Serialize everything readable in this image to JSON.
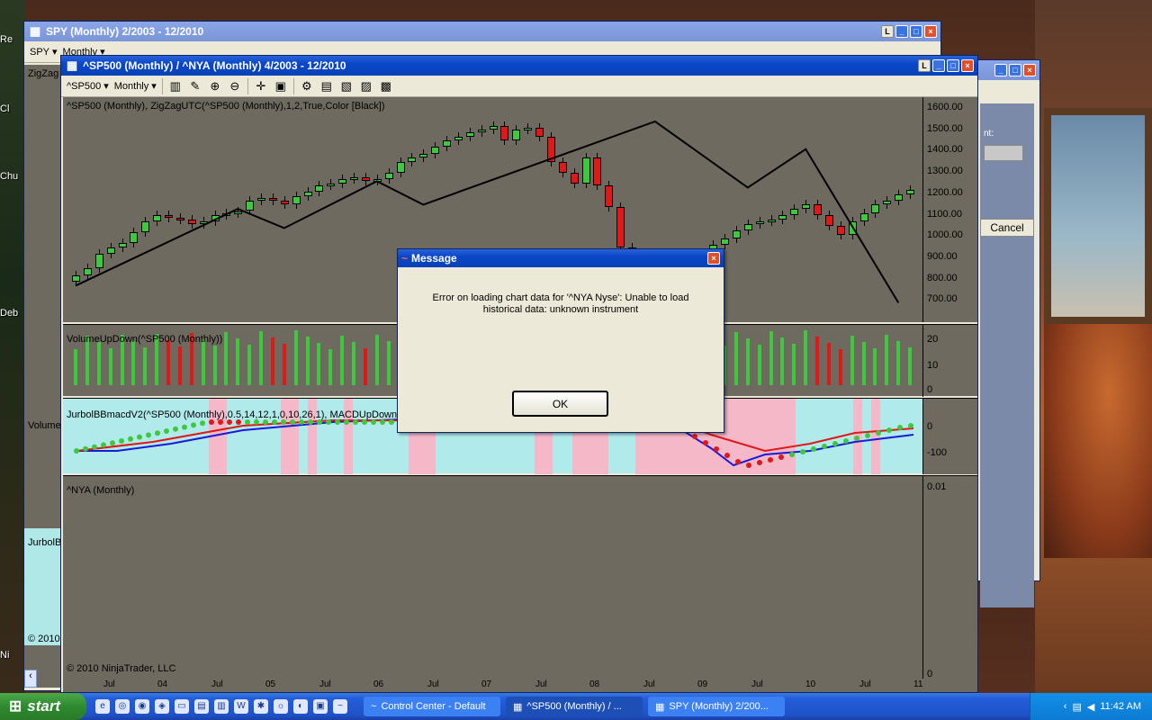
{
  "desktop": {
    "icons": [
      "Re",
      "Cl",
      "Chu",
      "Deb",
      "Ni"
    ]
  },
  "spy_window": {
    "title": "SPY (Monthly)  2/2003 - 12/2010",
    "instrument": "SPY",
    "interval": "Monthly",
    "side_labels": [
      "ZigZag",
      "Volume",
      "JurbolB"
    ],
    "copyright": "© 2010"
  },
  "back_window": {
    "cancel_label": "Cancel",
    "field_label": "nt:"
  },
  "main_window": {
    "title": "^SP500 (Monthly) / ^NYA (Monthly)  4/2003 - 12/2010",
    "instrument": "^SP500",
    "interval": "Monthly",
    "price_panel_label": "^SP500 (Monthly),  ZigZagUTC(^SP500 (Monthly),1,2,True,Color [Black])",
    "volume_panel_label": "VolumeUpDown(^SP500 (Monthly))",
    "macd_panel_label": "JurbolBBmacdV2(^SP500 (Monthly),0.5,14,12,1,0,10,26,1), MACDUpDownC",
    "nya_panel_label": "^NYA (Monthly)",
    "copyright": "© 2010 NinjaTrader, LLC",
    "price_ticks": [
      "1600.00",
      "1500.00",
      "1400.00",
      "1300.00",
      "1200.00",
      "1100.00",
      "1000.00",
      "900.00",
      "800.00",
      "700.00"
    ],
    "volume_ticks": [
      "20",
      "10",
      "0"
    ],
    "macd_ticks": [
      "0",
      "-100"
    ],
    "nya_ticks": [
      "0.01",
      "0"
    ],
    "x_ticks": [
      "Jul",
      "04",
      "Jul",
      "05",
      "Jul",
      "06",
      "Jul",
      "07",
      "Jul",
      "08",
      "Jul",
      "09",
      "Jul",
      "10",
      "Jul",
      "11"
    ]
  },
  "dialog": {
    "title": "Message",
    "message": "Error on loading chart data for '^NYA Nyse': Unable to load historical data: unknown instrument",
    "ok_label": "OK"
  },
  "taskbar": {
    "start_label": "start",
    "tasks": [
      {
        "label": "Control Center - Default"
      },
      {
        "label": "^SP500 (Monthly) / ..."
      },
      {
        "label": "SPY (Monthly)  2/200..."
      }
    ],
    "clock": "11:42 AM"
  },
  "chart_data": {
    "type": "candlestick",
    "title": "^SP500 (Monthly)",
    "ylim": [
      650,
      1650
    ],
    "approx_close": [
      850,
      880,
      950,
      980,
      1000,
      1050,
      1100,
      1130,
      1120,
      1110,
      1090,
      1100,
      1130,
      1140,
      1150,
      1200,
      1210,
      1200,
      1180,
      1220,
      1240,
      1270,
      1280,
      1300,
      1310,
      1290,
      1300,
      1330,
      1380,
      1400,
      1420,
      1450,
      1480,
      1500,
      1520,
      1530,
      1550,
      1480,
      1530,
      1540,
      1500,
      1380,
      1330,
      1280,
      1400,
      1270,
      1170,
      980,
      900,
      870,
      800,
      750,
      790,
      870,
      920,
      990,
      1020,
      1060,
      1090,
      1100,
      1110,
      1130,
      1160,
      1180,
      1130,
      1080,
      1040,
      1100,
      1140,
      1180,
      1200,
      1230,
      1250
    ]
  }
}
